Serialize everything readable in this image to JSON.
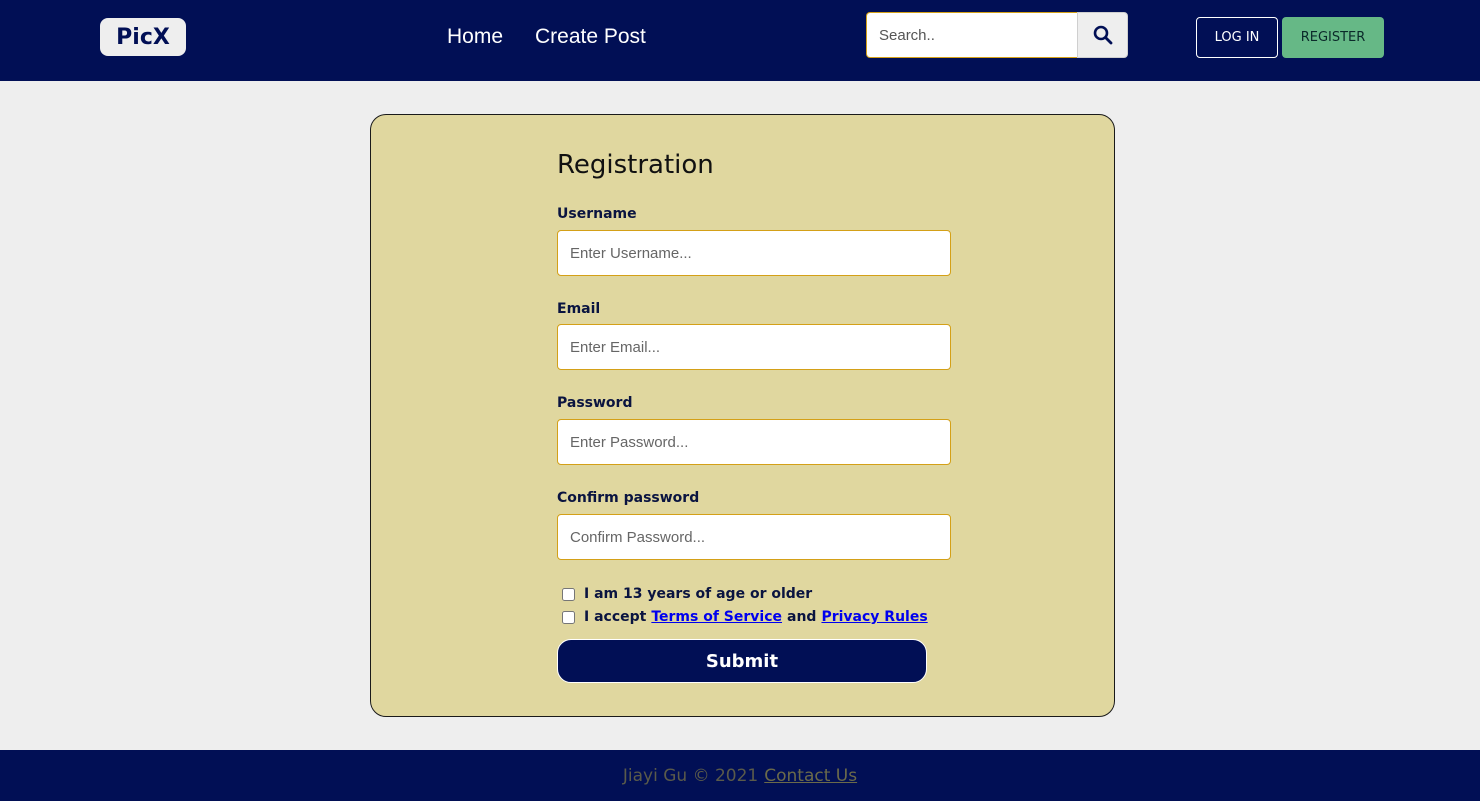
{
  "navbar": {
    "logo": "PicX",
    "links": [
      "Home",
      "Create Post"
    ],
    "search": {
      "placeholder": "Search..",
      "icon": "search-icon"
    },
    "login_label": "LOG IN",
    "register_label": "REGISTER"
  },
  "form": {
    "title": "Registration",
    "fields": [
      {
        "label": "Username",
        "placeholder": "Enter Username..."
      },
      {
        "label": "Email",
        "placeholder": "Enter Email..."
      },
      {
        "label": "Password",
        "placeholder": "Enter Password..."
      },
      {
        "label": "Confirm password",
        "placeholder": "Confirm Password..."
      }
    ],
    "age_check": "I am 13 years of age or older",
    "terms": {
      "prefix": "I accept",
      "terms_link": "Terms of Service",
      "middle": "and",
      "privacy_link": "Privacy Rules"
    },
    "submit_label": "Submit"
  },
  "footer": {
    "text": "Jiayi Gu © 2021",
    "link": "Contact Us"
  },
  "colors": {
    "navbar_bg": "#010f55",
    "card_bg": "#e0d79f",
    "register_bg": "#66b886",
    "input_border": "#d4a017"
  }
}
